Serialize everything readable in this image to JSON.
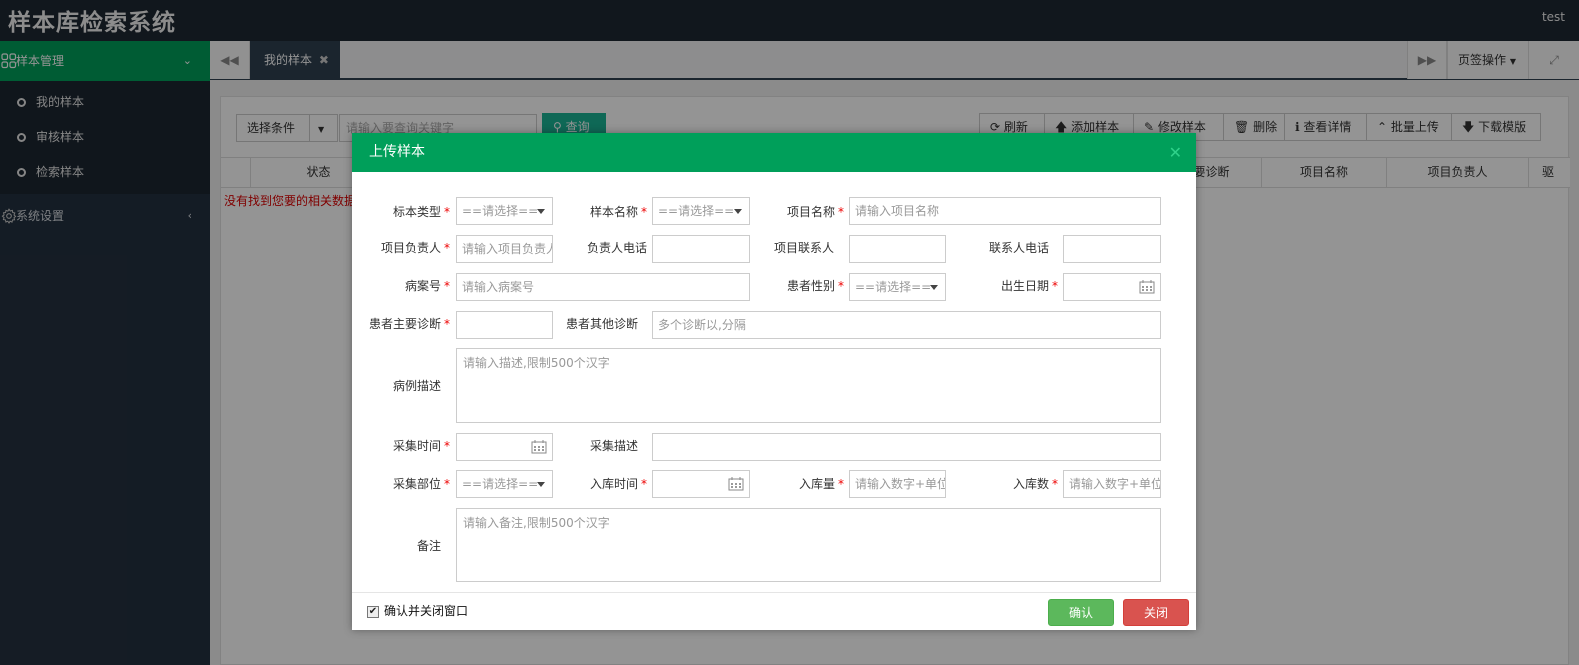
{
  "app": {
    "title": "样本库检索系统",
    "user": "test"
  },
  "sidebar": {
    "groups": [
      {
        "label": "样本管理",
        "icon": "grid-icon",
        "expanded": true,
        "items": [
          {
            "label": "我的样本"
          },
          {
            "label": "审核样本"
          },
          {
            "label": "检索样本"
          }
        ]
      },
      {
        "label": "系统设置",
        "icon": "gear-icon",
        "expanded": false
      }
    ]
  },
  "tabs": {
    "prev_icon": "backward-icon",
    "next_icon": "forward-icon",
    "active_tab": "我的样本",
    "page_ops": "页签操作",
    "fullscreen_icon": "expand-icon"
  },
  "toolbar": {
    "condition_select": "选择条件",
    "search_placeholder": "请输入要查询关键字",
    "query_button": "查询",
    "actions": [
      {
        "label": "刷新",
        "icon": "refresh-icon"
      },
      {
        "label": "添加样本",
        "icon": "arrow-up-icon"
      },
      {
        "label": "修改样本",
        "icon": "edit-icon"
      },
      {
        "label": "删除",
        "icon": "trash-icon"
      },
      {
        "label": "查看详情",
        "icon": "info-icon"
      },
      {
        "label": "批量上传",
        "icon": "double-up-icon"
      },
      {
        "label": "下载模版",
        "icon": "arrow-down-icon"
      }
    ]
  },
  "grid": {
    "columns": [
      "状态",
      "要诊断",
      "项目名称",
      "项目负责人",
      "驱"
    ],
    "empty_message": "没有找到您要的相关数据"
  },
  "modal": {
    "title": "上传样本",
    "fields": {
      "sample_type": {
        "label": "标本类型",
        "required": true,
        "value": "==请选择=="
      },
      "sample_name": {
        "label": "样本名称",
        "required": true,
        "value": "==请选择=="
      },
      "project_name": {
        "label": "项目名称",
        "required": true,
        "placeholder": "请输入项目名称"
      },
      "project_owner": {
        "label": "项目负责人",
        "required": true,
        "placeholder": "请输入项目负责人"
      },
      "owner_phone": {
        "label": "负责人电话",
        "required": false
      },
      "project_contact": {
        "label": "项目联系人",
        "required": false
      },
      "contact_phone": {
        "label": "联系人电话",
        "required": false
      },
      "case_no": {
        "label": "病案号",
        "required": true,
        "placeholder": "请输入病案号"
      },
      "patient_gender": {
        "label": "患者性别",
        "required": true,
        "value": "==请选择=="
      },
      "birth_date": {
        "label": "出生日期",
        "required": true
      },
      "main_diagnosis": {
        "label": "患者主要诊断",
        "required": true
      },
      "other_diagnosis": {
        "label": "患者其他诊断",
        "required": false,
        "placeholder": "多个诊断以,分隔"
      },
      "case_desc": {
        "label": "病例描述",
        "required": false,
        "placeholder": "请输入描述,限制500个汉字"
      },
      "collect_time": {
        "label": "采集时间",
        "required": true
      },
      "collect_desc": {
        "label": "采集描述",
        "required": false
      },
      "collect_site": {
        "label": "采集部位",
        "required": true,
        "value": "==请选择=="
      },
      "stock_time": {
        "label": "入库时间",
        "required": true
      },
      "stock_amount": {
        "label": "入库量",
        "required": true,
        "placeholder": "请输入数字+单位"
      },
      "stock_count": {
        "label": "入库数",
        "required": true,
        "placeholder": "请输入数字+单位"
      },
      "remark": {
        "label": "备注",
        "required": false,
        "placeholder": "请输入备注,限制500个汉字"
      }
    },
    "confirm_close_label": "确认并关闭窗口",
    "confirm_checked": true,
    "confirm_button": "确认",
    "close_button": "关闭",
    "close_icon": "close-icon"
  },
  "colors": {
    "brand_green": "#009f5a",
    "confirm": "#5cb85c",
    "danger": "#d9534f",
    "required": "#ee0000"
  }
}
